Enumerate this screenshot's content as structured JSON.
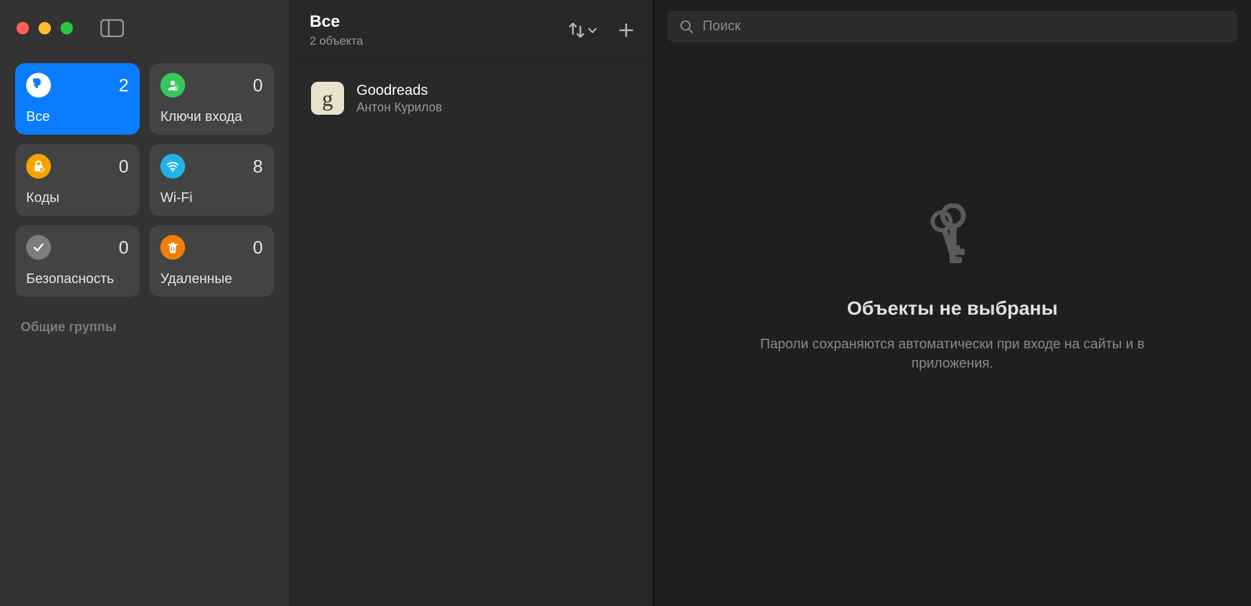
{
  "sidebar": {
    "categories": [
      {
        "id": "all",
        "label": "Все",
        "count": 2,
        "active": true,
        "icon": "key",
        "color": "#ffffff"
      },
      {
        "id": "passkeys",
        "label": "Ключи входа",
        "count": 0,
        "active": false,
        "icon": "person",
        "color": "#34c759"
      },
      {
        "id": "codes",
        "label": "Коды",
        "count": 0,
        "active": false,
        "icon": "lock",
        "color": "#f0a500"
      },
      {
        "id": "wifi",
        "label": "Wi-Fi",
        "count": 8,
        "active": false,
        "icon": "wifi",
        "color": "#1fb4e8"
      },
      {
        "id": "security",
        "label": "Безопасность",
        "count": 0,
        "active": false,
        "icon": "check",
        "color": "#7d7d7d"
      },
      {
        "id": "deleted",
        "label": "Удаленные",
        "count": 0,
        "active": false,
        "icon": "trash",
        "color": "#f27f0c"
      }
    ],
    "shared_groups_label": "Общие группы"
  },
  "list": {
    "title": "Все",
    "subtitle": "2 объекта",
    "items": [
      {
        "title": "Goodreads",
        "subtitle": "Антон Курилов",
        "glyph": "g"
      }
    ]
  },
  "search": {
    "placeholder": "Поиск",
    "value": ""
  },
  "detail": {
    "empty_title": "Объекты не выбраны",
    "empty_desc": "Пароли сохраняются автоматически при входе на сайты и в приложения."
  }
}
